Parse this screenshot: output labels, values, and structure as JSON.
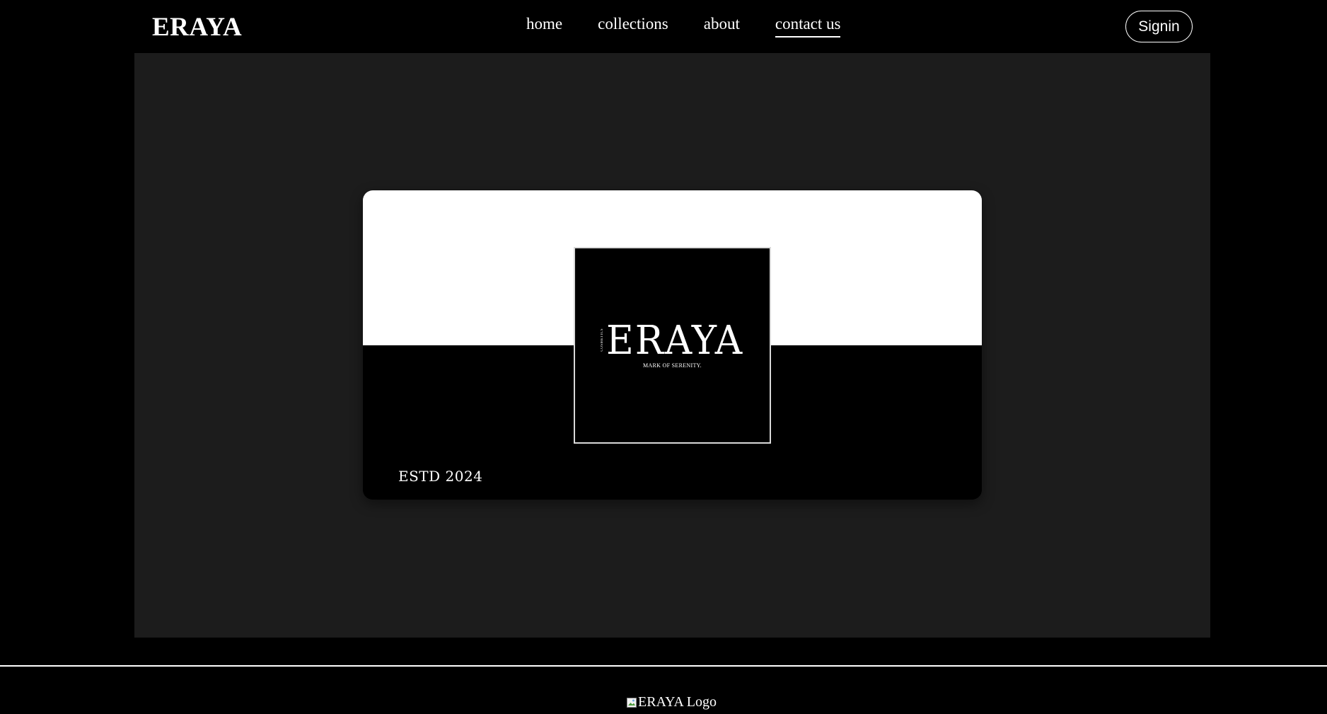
{
  "header": {
    "brand": "ERAYA",
    "nav": [
      {
        "label": "home"
      },
      {
        "label": "collections"
      },
      {
        "label": "about"
      },
      {
        "label": "contact us",
        "active": true
      }
    ],
    "signin_label": "Signin"
  },
  "hero": {
    "logo": {
      "wordmark": "ERAYA",
      "vertical_text": "COSMETICS",
      "tagline": "MARK OF SERENITY."
    },
    "estd": "ESTD 2024"
  },
  "footer": {
    "logo_alt": "ERAYA Logo",
    "logo_icon": "broken-image-icon"
  },
  "colors": {
    "background": "#000000",
    "panel": "#1c1c1c",
    "card_top": "#ffffff",
    "text": "#ffffff"
  }
}
